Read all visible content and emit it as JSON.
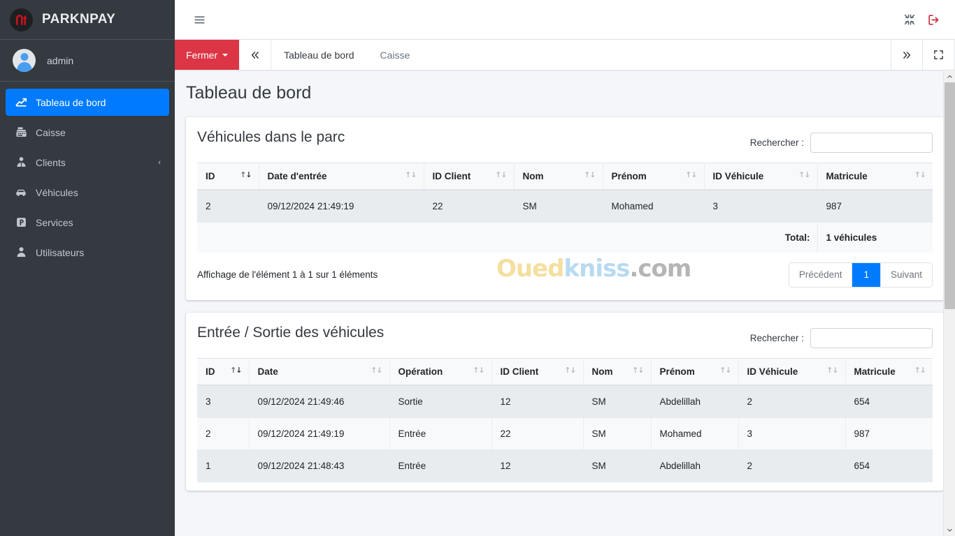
{
  "brand": {
    "name": "PARKNPAY",
    "logo_icon": "uturn-arrow-logo"
  },
  "user": {
    "name": "admin"
  },
  "sidebar": {
    "items": [
      {
        "label": "Tableau de bord",
        "icon": "chart-line-icon",
        "active": true
      },
      {
        "label": "Caisse",
        "icon": "cash-register-icon",
        "active": false
      },
      {
        "label": "Clients",
        "icon": "user-tie-icon",
        "active": false,
        "expandable": true,
        "arrow": "‹"
      },
      {
        "label": "Véhicules",
        "icon": "car-icon",
        "active": false
      },
      {
        "label": "Services",
        "icon": "parking-icon",
        "active": false
      },
      {
        "label": "Utilisateurs",
        "icon": "user-icon",
        "active": false
      }
    ]
  },
  "navbar": {
    "menu_toggle_icon": "hamburger-icon",
    "compress_icon": "compress-arrows-icon",
    "logout_icon": "logout-icon"
  },
  "tabbar": {
    "close_label": "Fermer",
    "prev_icon": "chevron-double-left-icon",
    "next_icon": "chevron-double-right-icon",
    "fullscreen_icon": "expand-icon",
    "tabs": [
      {
        "label": "Tableau de bord",
        "active": true
      },
      {
        "label": "Caisse",
        "active": false
      }
    ]
  },
  "page": {
    "title": "Tableau de bord"
  },
  "watermark": {
    "part1": "Oued",
    "part2": "kniss",
    "part3": ".com"
  },
  "card_parc": {
    "title": "Véhicules dans le parc",
    "search_label": "Rechercher :",
    "search_value": "",
    "search_placeholder": "",
    "columns": [
      "ID",
      "Date d'entrée",
      "ID Client",
      "Nom",
      "Prénom",
      "ID Véhicule",
      "Matricule"
    ],
    "sorted_column_index": 0,
    "sort_direction": "desc",
    "rows": [
      [
        "2",
        "09/12/2024 21:49:19",
        "22",
        "SM",
        "Mohamed",
        "3",
        "987"
      ]
    ],
    "footer_label": "Total:",
    "footer_value": "1 véhicules",
    "info": "Affichage de l'élément 1 à 1 sur 1 éléments",
    "pagination": {
      "prev": "Précédent",
      "pages": [
        "1"
      ],
      "current": "1",
      "next": "Suivant"
    }
  },
  "card_mouvements": {
    "title": "Entrée / Sortie des véhicules",
    "search_label": "Rechercher :",
    "search_value": "",
    "search_placeholder": "",
    "columns": [
      "ID",
      "Date",
      "Opération",
      "ID Client",
      "Nom",
      "Prénom",
      "ID Véhicule",
      "Matricule"
    ],
    "sorted_column_index": 0,
    "sort_direction": "desc",
    "rows": [
      {
        "id": "3",
        "date": "09/12/2024 21:49:46",
        "operation": "Sortie",
        "op_type": "sortie",
        "id_client": "12",
        "nom": "SM",
        "prenom": "Abdelillah",
        "id_vehicule": "2",
        "matricule": "654"
      },
      {
        "id": "2",
        "date": "09/12/2024 21:49:19",
        "operation": "Entrée",
        "op_type": "entree",
        "id_client": "22",
        "nom": "SM",
        "prenom": "Mohamed",
        "id_vehicule": "3",
        "matricule": "987"
      },
      {
        "id": "1",
        "date": "09/12/2024 21:48:43",
        "operation": "Entrée",
        "op_type": "entree",
        "id_client": "12",
        "nom": "SM",
        "prenom": "Abdelillah",
        "id_vehicule": "2",
        "matricule": "654"
      }
    ]
  },
  "colors": {
    "sidebar_bg": "#343a40",
    "accent_blue": "#007bff",
    "danger_red": "#dc3545",
    "success_green": "#28a745",
    "page_bg": "#f4f6f9"
  }
}
